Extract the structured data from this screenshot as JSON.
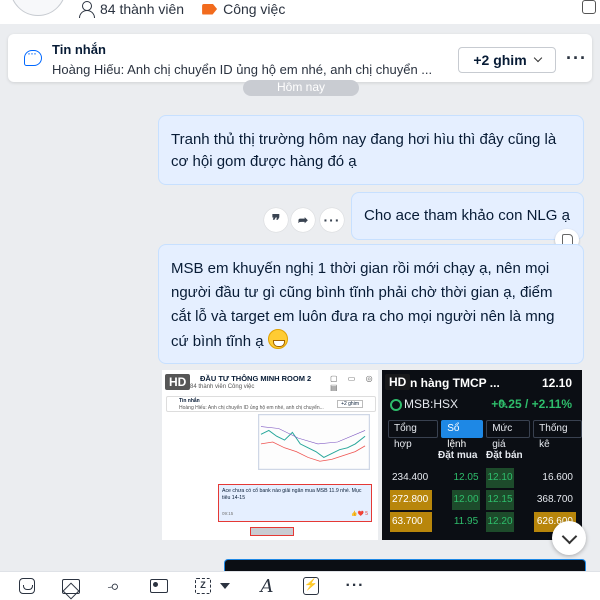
{
  "header": {
    "members": "84 thành viên",
    "category": "Công việc",
    "icons": [
      "avatar",
      "person-icon",
      "tag-icon"
    ]
  },
  "pinned": {
    "title": "Tin nhắn",
    "preview": "Hoàng Hiếu: Anh chị chuyển ID ủng hộ em nhé, anh chị chuyển ...",
    "pin_button": "+2 ghim",
    "more": "···"
  },
  "date_chip": "Hôm nay",
  "messages": [
    {
      "text": "Tranh thủ thị trường hôm nay đang hơi hìu thì đây cũng là cơ hội gom được hàng đó ạ"
    },
    {
      "text": "Cho ace tham khảo con NLG ạ"
    },
    {
      "text": "MSB em khuyến nghị 1 thời gian rồi mới chạy ạ, nên mọi người đầu tư gì cũng bình tĩnh phải chờ thời gian ạ, điểm cắt lỗ và target em luôn đưa ra cho mọi người nên là mng cứ bình tĩnh ạ"
    }
  ],
  "message_actions": {
    "quote": "❞",
    "forward": "➦",
    "more": "···"
  },
  "attachments": {
    "left": {
      "badge": "HD",
      "title": "ĐẦU TƯ THÔNG MINH ROOM 2",
      "members": "84 thành viên   Công việc",
      "pin_title": "Tin nhắn",
      "pin_preview": "Hoàng Hiếu: Anh chị chuyển ID ủng hộ em nhé, anh chị chuyển...",
      "pin_button": "+2 ghim",
      "chat_text": "Ace chưa có cổ bank nào giải ngân mua MSB 11.9 nhé. Mục tiêu 14-15",
      "chat_time": "09:15",
      "chat_reactions": "👍❤️ 5"
    },
    "right": {
      "badge": "HD",
      "title": "n hàng TMCP ...",
      "price": "12.10",
      "symbol": "MSB:HSX",
      "change": "+0.25 / +2.11%",
      "tabs": [
        {
          "label": "Tổng hợp",
          "active": false
        },
        {
          "label": "Sổ lệnh",
          "active": true
        },
        {
          "label": "Mức giá",
          "active": false
        },
        {
          "label": "Thống kê",
          "active": false
        }
      ],
      "bid_header": "Đặt mua",
      "ask_header": "Đặt bán",
      "rows": [
        {
          "bid_vol": "234.400",
          "bid": "12.05",
          "ask": "12.10",
          "ask_vol": "16.600"
        },
        {
          "bid_vol": "272.800",
          "bid": "12.00",
          "ask": "12.15",
          "ask_vol": "368.700"
        },
        {
          "bid_vol": "63.700",
          "bid": "11.95",
          "ask": "12.20",
          "ask_vol": "626.600"
        }
      ]
    }
  },
  "toolbar": {
    "icons": [
      "sticker-icon",
      "image-icon",
      "paperclip-icon",
      "contact-card-icon",
      "screenshot-icon",
      "chevron-down-icon",
      "text-format-icon",
      "quick-message-icon",
      "more-icon"
    ],
    "format_glyph": "A",
    "more": "···"
  }
}
